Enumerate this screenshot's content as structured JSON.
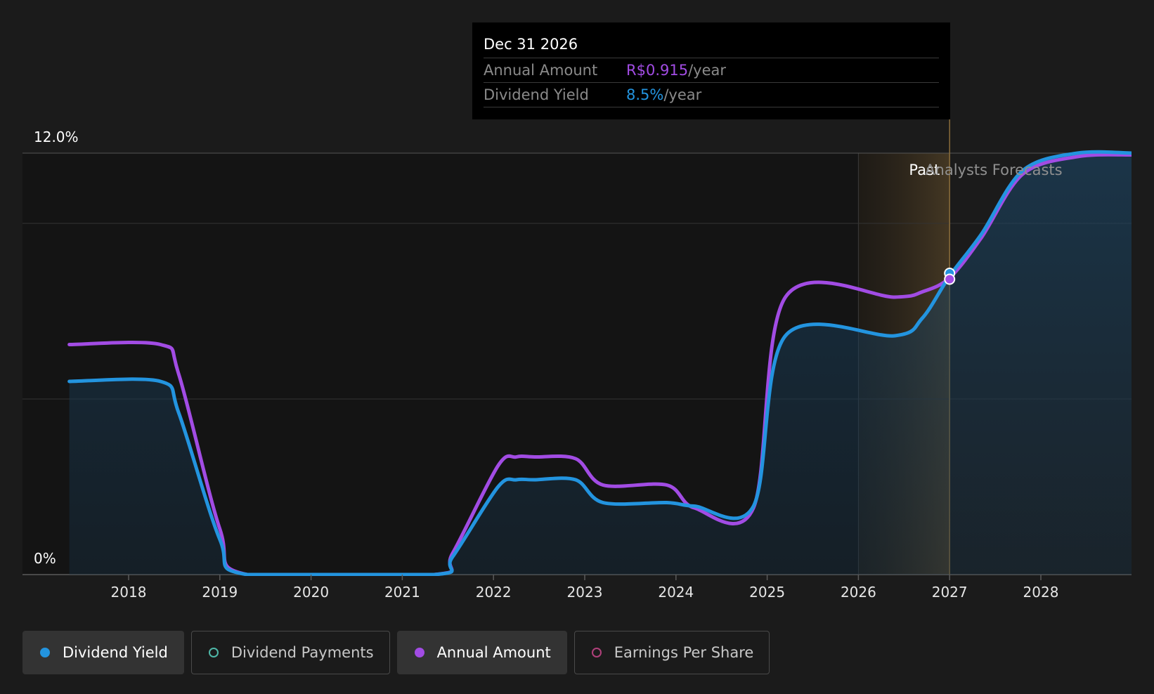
{
  "chart_data": {
    "type": "area",
    "title": "",
    "xlabel": "",
    "ylabel": "",
    "y_unit": "%",
    "ylim": [
      0,
      12
    ],
    "y_ticks_labeled": [
      "0%",
      "12.0%"
    ],
    "x_ticks": [
      "2018",
      "2019",
      "2020",
      "2021",
      "2022",
      "2023",
      "2024",
      "2025",
      "2026",
      "2027",
      "2028"
    ],
    "xlim": [
      2017.0,
      2029.0
    ],
    "grid": true,
    "regions": {
      "past_label": "Past",
      "forecast_label": "Analysts Forecasts",
      "divider_x": 2027.0
    },
    "series": [
      {
        "name": "Dividend Yield",
        "color": "#2394df",
        "filled": true,
        "points": [
          [
            2017.35,
            5.5
          ],
          [
            2018.35,
            5.5
          ],
          [
            2018.55,
            4.6
          ],
          [
            2019.0,
            1.0
          ],
          [
            2019.3,
            0.0
          ],
          [
            2021.35,
            0.0
          ],
          [
            2021.55,
            0.5
          ],
          [
            2022.05,
            2.5
          ],
          [
            2022.25,
            2.7
          ],
          [
            2022.45,
            2.7
          ],
          [
            2022.9,
            2.7
          ],
          [
            2023.2,
            2.05
          ],
          [
            2023.9,
            2.05
          ],
          [
            2024.2,
            1.95
          ],
          [
            2024.85,
            1.95
          ],
          [
            2025.2,
            6.8
          ],
          [
            2026.4,
            6.8
          ],
          [
            2026.7,
            7.3
          ],
          [
            2027.0,
            8.5
          ],
          [
            2027.35,
            9.7
          ],
          [
            2027.8,
            11.5
          ],
          [
            2028.4,
            12.0
          ],
          [
            2029.0,
            12.0
          ]
        ]
      },
      {
        "name": "Annual Amount",
        "color": "#a24ce4",
        "filled": false,
        "points": [
          [
            2017.35,
            6.55
          ],
          [
            2018.35,
            6.55
          ],
          [
            2018.55,
            5.7
          ],
          [
            2019.0,
            1.3
          ],
          [
            2019.3,
            0.0
          ],
          [
            2021.35,
            0.0
          ],
          [
            2021.55,
            0.6
          ],
          [
            2022.05,
            3.1
          ],
          [
            2022.25,
            3.35
          ],
          [
            2022.45,
            3.35
          ],
          [
            2022.9,
            3.3
          ],
          [
            2023.2,
            2.55
          ],
          [
            2023.9,
            2.55
          ],
          [
            2024.2,
            1.9
          ],
          [
            2024.85,
            1.9
          ],
          [
            2025.2,
            7.9
          ],
          [
            2026.4,
            7.9
          ],
          [
            2026.7,
            8.05
          ],
          [
            2027.0,
            8.45
          ],
          [
            2027.35,
            9.6
          ],
          [
            2027.8,
            11.4
          ],
          [
            2028.4,
            11.9
          ],
          [
            2029.0,
            11.95
          ]
        ]
      }
    ]
  },
  "tooltip": {
    "date": "Dec 31 2026",
    "rows": [
      {
        "label": "Annual Amount",
        "value": "R$0.915",
        "unit": "/year",
        "color": "#a24ce4"
      },
      {
        "label": "Dividend Yield",
        "value": "8.5%",
        "unit": "/year",
        "color": "#2394df"
      }
    ]
  },
  "legend": [
    {
      "label": "Dividend Yield",
      "active": true,
      "dot_color": "#2394df",
      "hollow": false
    },
    {
      "label": "Dividend Payments",
      "active": false,
      "dot_color": "#4fb8a8",
      "hollow": true
    },
    {
      "label": "Annual Amount",
      "active": true,
      "dot_color": "#a24ce4",
      "hollow": false
    },
    {
      "label": "Earnings Per Share",
      "active": false,
      "dot_color": "#b0407a",
      "hollow": true
    }
  ]
}
